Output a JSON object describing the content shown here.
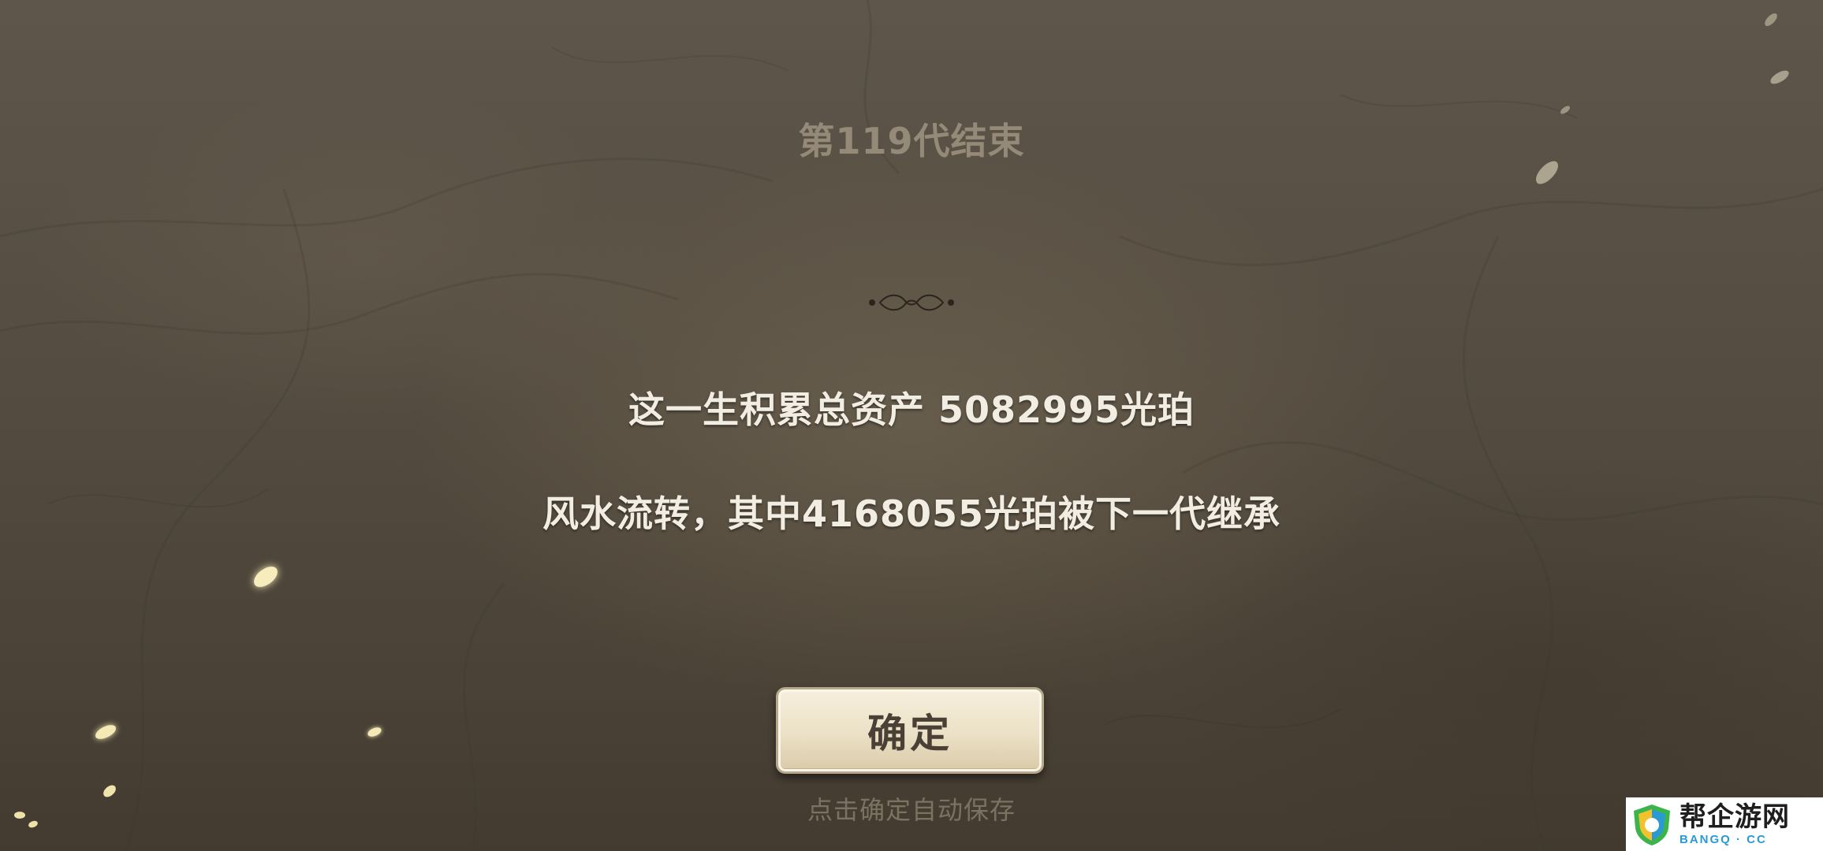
{
  "result": {
    "title": "第119代结束",
    "assets_line": "这一生积累总资产 5082995光珀",
    "inherit_line": "风水流转，其中4168055光珀被下一代继承"
  },
  "actions": {
    "confirm_label": "确定",
    "autosave_hint": "点击确定自动保存"
  },
  "watermark": {
    "name": "帮企游网",
    "domain": "BANGQ · CC"
  },
  "colors": {
    "background": "#544c40",
    "title_text": "#958a78",
    "body_text": "#f2ede2",
    "button_face": "#ece1c6",
    "hint_text": "#7c7262",
    "petal": "#f5e9b5"
  },
  "icons": [
    "ornament-divider-icon",
    "petal-icon",
    "shield-logo-icon"
  ]
}
